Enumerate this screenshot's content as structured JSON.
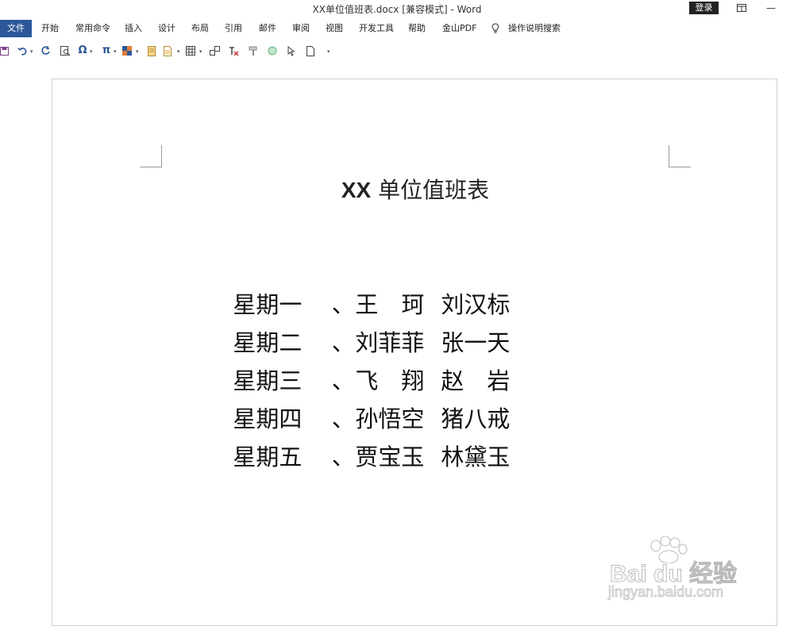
{
  "window": {
    "title": "XX单位值班表.docx [兼容模式]  -  Word",
    "login_label": "登录",
    "restore_icon": "ribbon-display-icon",
    "minimize_glyph": "—"
  },
  "ribbon": {
    "tabs": [
      "文件",
      "开始",
      "常用命令",
      "插入",
      "设计",
      "布局",
      "引用",
      "邮件",
      "审阅",
      "视图",
      "开发工具",
      "帮助",
      "金山PDF"
    ],
    "active_tab": "文件",
    "tell_me": "操作说明搜索",
    "accent": "#2b579a"
  },
  "quick_toolbar": {
    "icons": [
      "save-icon",
      "undo-icon",
      "redo-icon",
      "print-preview-icon",
      "omega-symbol-icon",
      "pi-equation-icon",
      "color-fill-icon",
      "document-icon",
      "page-icon",
      "table-icon",
      "shapes-icon",
      "clear-format-icon",
      "format-painter-icon",
      "circle-icon",
      "select-pointer-icon",
      "new-page-icon",
      "customize-icon"
    ],
    "omega": "Ω",
    "pi": "π"
  },
  "document": {
    "heading_latin": "XX",
    "heading_cjk": "单位值班表",
    "rows": [
      {
        "day": "星期一",
        "sep": "、",
        "a": [
          "王",
          "",
          "珂"
        ],
        "b": [
          "刘",
          "汉",
          "标"
        ]
      },
      {
        "day": "星期二",
        "sep": "、",
        "a": [
          "刘",
          "菲",
          "菲"
        ],
        "b": [
          "张",
          "一",
          "天"
        ]
      },
      {
        "day": "星期三",
        "sep": "、",
        "a": [
          "飞",
          "",
          "翔"
        ],
        "b": [
          "赵",
          "",
          "岩"
        ]
      },
      {
        "day": "星期四",
        "sep": "、",
        "a": [
          "孙",
          "悟",
          "空"
        ],
        "b": [
          "猪",
          "八",
          "戒"
        ]
      },
      {
        "day": "星期五",
        "sep": "、",
        "a": [
          "贾",
          "宝",
          "玉"
        ],
        "b": [
          "林",
          "黛",
          "玉"
        ]
      }
    ]
  },
  "watermark": {
    "brand": "Bai du 经验",
    "url": "jingyan.baidu.com"
  }
}
